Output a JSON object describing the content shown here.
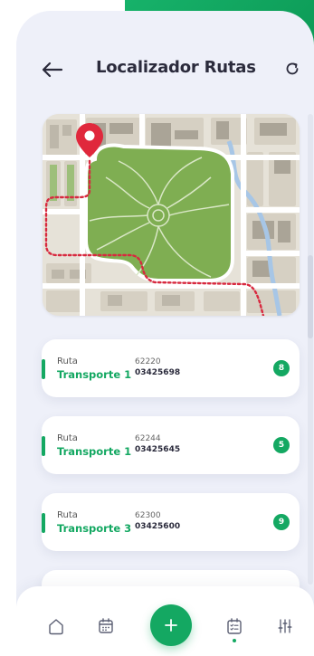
{
  "header": {
    "title": "Localizador Rutas",
    "back_icon": "arrow-left-icon",
    "refresh_icon": "refresh-icon"
  },
  "colors": {
    "accent": "#14a862",
    "background": "#eef0f9",
    "title": "#2b2b3c"
  },
  "routes": [
    {
      "label": "Ruta",
      "name": "Transporte 1",
      "code": "62220",
      "id": "03425698",
      "count": "8"
    },
    {
      "label": "Ruta",
      "name": "Transporte 1",
      "code": "62244",
      "id": "03425645",
      "count": "5"
    },
    {
      "label": "Ruta",
      "name": "Transporte 3",
      "code": "62300",
      "id": "03425600",
      "count": "9"
    }
  ],
  "nav": {
    "items": [
      "home-icon",
      "calendar-icon",
      "add-icon",
      "checklist-calendar-icon",
      "sliders-icon"
    ],
    "active": "checklist-calendar-icon"
  }
}
